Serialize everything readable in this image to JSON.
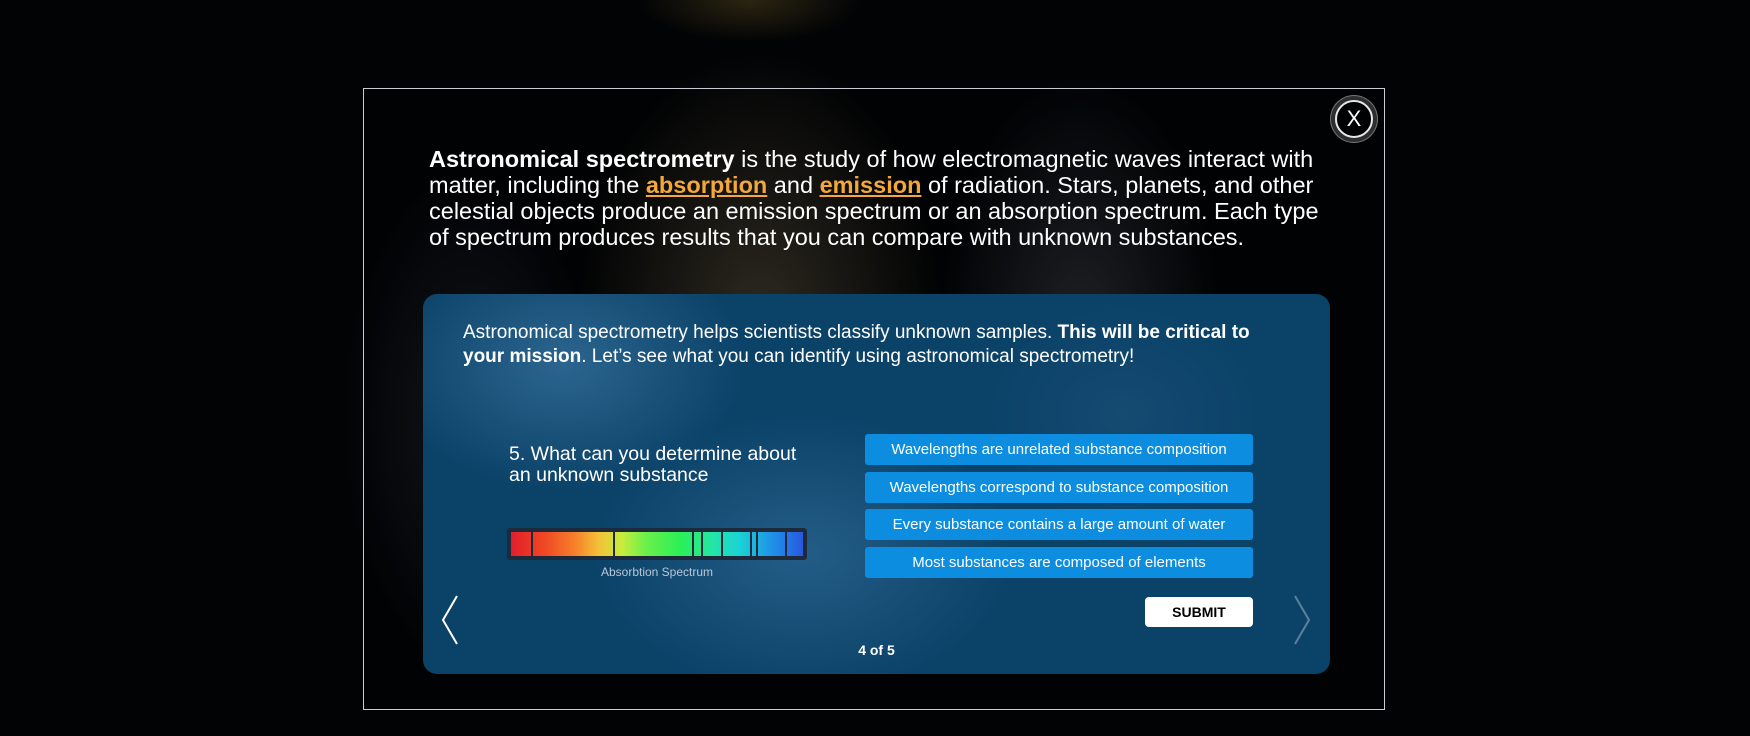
{
  "close": {
    "label": "X"
  },
  "intro": {
    "term": "Astronomical spectrometry",
    "text1": " is the study of how electromagnetic waves interact with matter, including the ",
    "keyword1": "absorption",
    "text2": " and ",
    "keyword2": "emission",
    "text3": " of radiation. Stars, planets, and other celestial objects produce an emission spectrum or an absorption spectrum. Each type of spectrum produces results that you can compare with unknown substances."
  },
  "panel": {
    "text1": "Astronomical spectrometry helps scientists classify unknown samples. ",
    "bold": "This will be critical to your mission",
    "text2": ". Let’s see what you can identify using astronomical spectrometry!"
  },
  "quiz": {
    "question": "5. What can you determine about an unknown substance",
    "spectrum_label": "Absorbtion Spectrum",
    "answers": [
      "Wavelengths are unrelated substance composition",
      "Wavelengths correspond to substance composition",
      "Every substance contains a large amount of water",
      "Most substances are composed of elements"
    ],
    "submit_label": "SUBMIT",
    "counter": "4 of 5"
  },
  "colors": {
    "keyword": "#f4a83a",
    "answer_bg": "#0d8ddf",
    "panel_bg": "#0b4268"
  },
  "icons": {
    "close": "close-icon",
    "prev": "chevron-left-icon",
    "next": "chevron-right-icon"
  }
}
